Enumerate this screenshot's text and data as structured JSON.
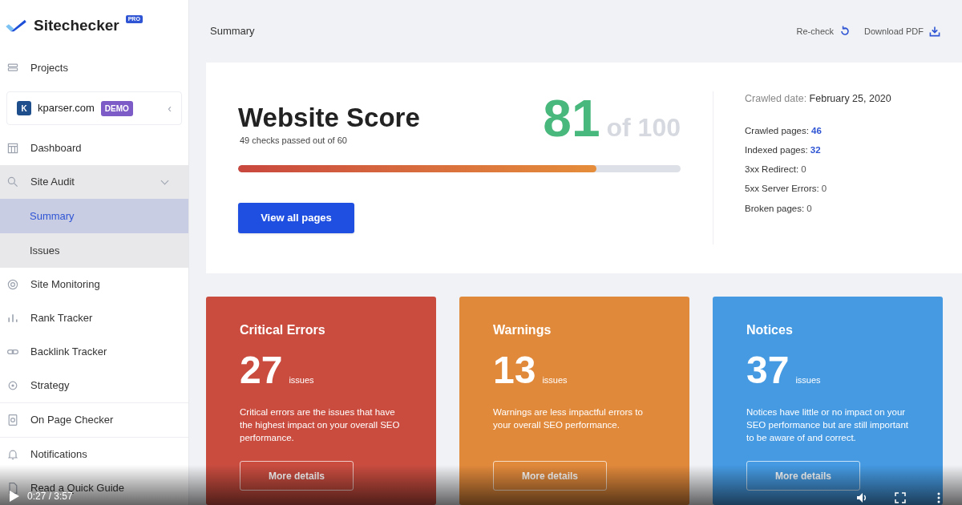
{
  "logo": {
    "name": "Sitechecker",
    "badge": "PRO"
  },
  "sidebar": {
    "items": [
      {
        "kind": "link",
        "label": "Projects",
        "selected": false
      },
      {
        "kind": "project",
        "initial": "K",
        "label": "kparser.com",
        "badge": "DEMO",
        "toggle": "‹"
      },
      {
        "kind": "link",
        "label": "Dashboard",
        "selected": false
      },
      {
        "kind": "group",
        "label": "Site Audit",
        "expanded": true,
        "children": [
          {
            "label": "Summary",
            "selected": true
          },
          {
            "label": "Issues",
            "selected": false
          }
        ]
      },
      {
        "kind": "link",
        "label": "Site Monitoring",
        "selected": false
      },
      {
        "kind": "link",
        "label": "Rank Tracker",
        "selected": false
      },
      {
        "kind": "link",
        "label": "Backlink Tracker",
        "selected": false
      },
      {
        "kind": "link",
        "label": "Strategy",
        "selected": false
      },
      {
        "kind": "link",
        "label": "On Page Checker",
        "selected": false
      },
      {
        "kind": "link",
        "label": "Notifications",
        "selected": false
      },
      {
        "kind": "link",
        "label": "Read a Quick Guide",
        "selected": false
      }
    ]
  },
  "header": {
    "title": "Summary",
    "actions": [
      {
        "label": "Re-check"
      },
      {
        "label": "Download PDF"
      }
    ]
  },
  "score": {
    "title": "Website Score",
    "subtitle": "49 checks passed out of 60",
    "value": "81",
    "of": "of 100",
    "level": 0.81,
    "button": "View all pages"
  },
  "crawl": {
    "date_label": "Crawled date:",
    "date": "February 25, 2020",
    "stats": [
      {
        "label": "Crawled pages:",
        "value": "46",
        "highlight": true
      },
      {
        "label": "Indexed pages:",
        "value": "32",
        "highlight": true
      },
      {
        "label": "3xx Redirect:",
        "value": "0",
        "highlight": false
      },
      {
        "label": "5xx Server Errors:",
        "value": "0",
        "highlight": false
      },
      {
        "label": "Broken pages:",
        "value": "0",
        "highlight": false
      }
    ]
  },
  "cards": [
    {
      "title": "Critical Errors",
      "count": "27",
      "unit": "issues",
      "text": "Critical errors are the issues that have the highest impact on your overall SEO performance.",
      "button": "More details",
      "color": "#c94c3f"
    },
    {
      "title": "Warnings",
      "count": "13",
      "unit": "issues",
      "text": "Warnings are less impactful errors to your overall SEO performance.",
      "button": "More details",
      "color": "#e1893b"
    },
    {
      "title": "Notices",
      "count": "37",
      "unit": "issues",
      "text": "Notices have little or no impact on your SEO performance but are still important to be aware of and correct.",
      "button": "More details",
      "color": "#459ae2"
    }
  ],
  "video_player": {
    "time": "0:27 / 3:57"
  }
}
